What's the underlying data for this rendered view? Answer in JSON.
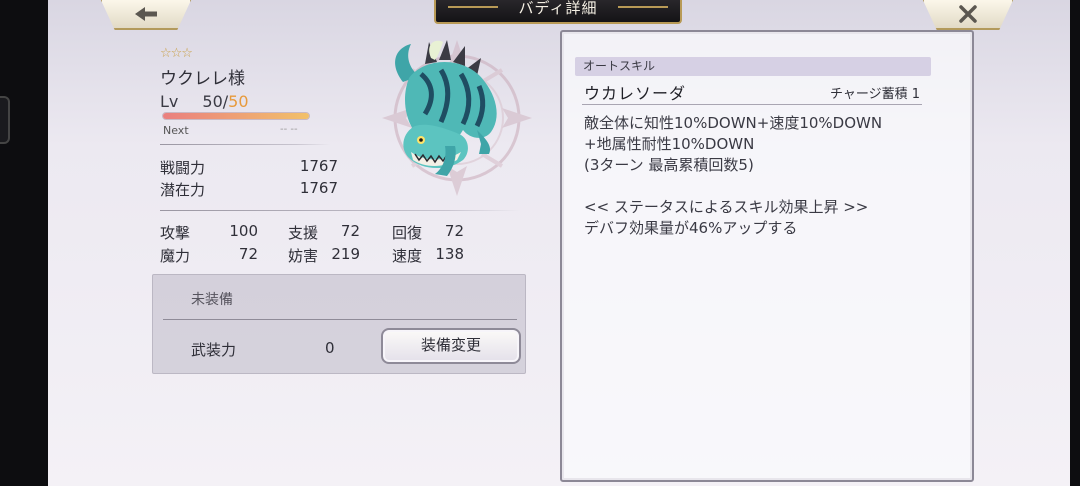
{
  "header": {
    "title": "バディ詳細",
    "back_icon": "left-arrow-icon",
    "close_icon": "close-x-icon"
  },
  "character": {
    "rarity_stars": "☆☆☆",
    "name": "ウクレレ様",
    "level_label": "Lv",
    "level_current": "50/",
    "level_max": "50",
    "xp_progress": 1.0,
    "next_label": "Next",
    "next_value": "-- --"
  },
  "stats": {
    "combat_power_label": "戦闘力",
    "combat_power_value": "1767",
    "potential_label": "潜在力",
    "potential_value": "1767"
  },
  "attributes": [
    {
      "label": "攻撃",
      "value": "100"
    },
    {
      "label": "支援",
      "value": "72"
    },
    {
      "label": "回復",
      "value": "72"
    },
    {
      "label": "魔力",
      "value": "72"
    },
    {
      "label": "妨害",
      "value": "219"
    },
    {
      "label": "速度",
      "value": "138"
    }
  ],
  "equipment": {
    "status": "未装備",
    "armament_label": "武装力",
    "armament_value": "0",
    "change_button": "装備変更"
  },
  "skill": {
    "section_label": "オートスキル",
    "name": "ウカレソーダ",
    "charge": "チャージ蓄積 1",
    "description_lines": [
      "敵全体に知性10%DOWN+速度10%DOWN",
      "+地属性耐性10%DOWN",
      "(3ターン 最高累積回数5)",
      "",
      "<< ステータスによるスキル効果上昇 >>",
      "デバフ効果量が46%アップする"
    ]
  },
  "colors": {
    "gold_trim": "#b89a56",
    "level_max": "#e79a3c",
    "skill_tag_bg": "#d6d0e4"
  }
}
